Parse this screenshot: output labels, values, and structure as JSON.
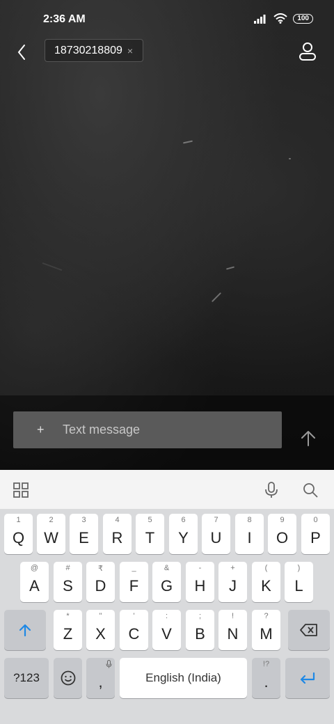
{
  "status_bar": {
    "time": "2:36 AM",
    "battery": "100",
    "signal_icon": "signal-icon",
    "wifi_icon": "wifi-icon"
  },
  "header": {
    "back_icon": "chevron-left-icon",
    "recipient": "18730218809",
    "remove_recipient": "×",
    "contact_icon": "person-icon"
  },
  "composer": {
    "plus": "+",
    "placeholder": "Text message",
    "send_icon": "arrow-up-icon"
  },
  "keyboard_toolbar": {
    "apps_icon": "grid-icon",
    "mic_icon": "microphone-icon",
    "search_icon": "search-icon"
  },
  "keyboard": {
    "row1": [
      {
        "main": "Q",
        "hint": "1"
      },
      {
        "main": "W",
        "hint": "2"
      },
      {
        "main": "E",
        "hint": "3"
      },
      {
        "main": "R",
        "hint": "4"
      },
      {
        "main": "T",
        "hint": "5"
      },
      {
        "main": "Y",
        "hint": "6"
      },
      {
        "main": "U",
        "hint": "7"
      },
      {
        "main": "I",
        "hint": "8"
      },
      {
        "main": "O",
        "hint": "9"
      },
      {
        "main": "P",
        "hint": "0"
      }
    ],
    "row2": [
      {
        "main": "A",
        "hint": "@"
      },
      {
        "main": "S",
        "hint": "#"
      },
      {
        "main": "D",
        "hint": "₹"
      },
      {
        "main": "F",
        "hint": "_"
      },
      {
        "main": "G",
        "hint": "&"
      },
      {
        "main": "H",
        "hint": "-"
      },
      {
        "main": "J",
        "hint": "+"
      },
      {
        "main": "K",
        "hint": "("
      },
      {
        "main": "L",
        "hint": ")"
      }
    ],
    "row3": [
      {
        "main": "Z",
        "hint": "*"
      },
      {
        "main": "X",
        "hint": "\""
      },
      {
        "main": "C",
        "hint": "'"
      },
      {
        "main": "V",
        "hint": ":"
      },
      {
        "main": "B",
        "hint": ";"
      },
      {
        "main": "N",
        "hint": "!"
      },
      {
        "main": "M",
        "hint": "?"
      }
    ],
    "shift_icon": "shift-arrow-icon",
    "backspace_icon": "backspace-icon",
    "symbols": "?123",
    "emoji_icon": "smiley-icon",
    "comma": ",",
    "space": "English (India)",
    "period": ".",
    "period_hint": "!?",
    "enter_icon": "enter-icon",
    "accent_color": "#1e88e5"
  }
}
